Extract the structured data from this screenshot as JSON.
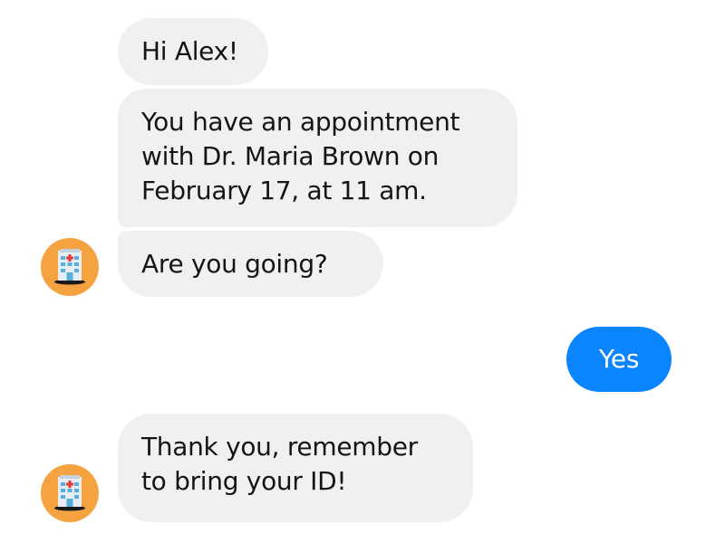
{
  "conversation": {
    "messages": [
      {
        "sender": "bot",
        "lines": [
          "Hi Alex!"
        ]
      },
      {
        "sender": "bot",
        "lines": [
          "You have an appointment",
          "with Dr. Maria Brown on",
          "February 17, at 11 am."
        ]
      },
      {
        "sender": "bot",
        "lines": [
          "Are you going?"
        ]
      },
      {
        "sender": "user",
        "lines": [
          "Yes"
        ]
      },
      {
        "sender": "bot",
        "lines": [
          "Thank you, remember",
          "to bring your ID!"
        ]
      }
    ],
    "bot_avatar_icon": "hospital-icon"
  },
  "colors": {
    "incoming_bubble": "#f0f0f0",
    "outgoing_bubble": "#0a84ff",
    "avatar_background": "#f5a340",
    "text": "#151515"
  }
}
